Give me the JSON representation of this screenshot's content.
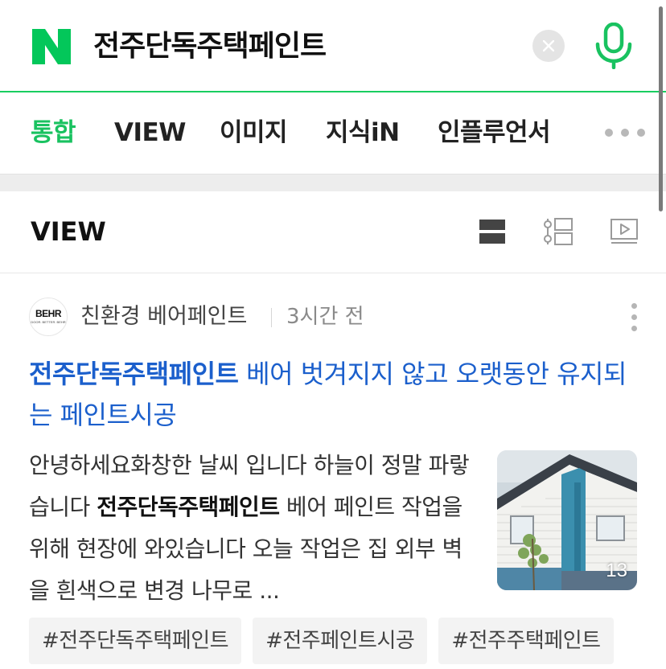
{
  "search": {
    "query": "전주단독주택페인트",
    "accent_color": "#19ce60"
  },
  "tabs": [
    {
      "label": "통합",
      "active": true
    },
    {
      "label": "VIEW",
      "active": false
    },
    {
      "label": "이미지",
      "active": false
    },
    {
      "label": "지식iN",
      "active": false
    },
    {
      "label": "인플루언서",
      "active": false
    }
  ],
  "view_section": {
    "title": "VIEW",
    "icons": [
      "list-view-icon",
      "timeline-view-icon",
      "video-view-icon"
    ]
  },
  "post": {
    "avatar_text": "BEHR",
    "avatar_subtext": "DOOR. BETTER. BEHR",
    "author": "친환경 베어페인트",
    "time": "3시간 전",
    "title_highlight": "전주단독주택페인트",
    "title_rest": " 베어 벗겨지지 않고 오랫동안 유지되는 페인트시공",
    "body_before": "안녕하세요화창한 날씨 입니다 하늘이 정말 파랗습니다 ",
    "body_highlight": "전주단독주택페인트",
    "body_after": " 베어 페인트 작업을 위해 현장에 와있습니다 오늘 작업은 집 외부 벽을 흰색으로 변경 나무로 ...",
    "image_count": "13",
    "title_color": "#1b5fcc"
  },
  "tags": [
    "#전주단독주택페인트",
    "#전주페인트시공",
    "#전주주택페인트"
  ]
}
